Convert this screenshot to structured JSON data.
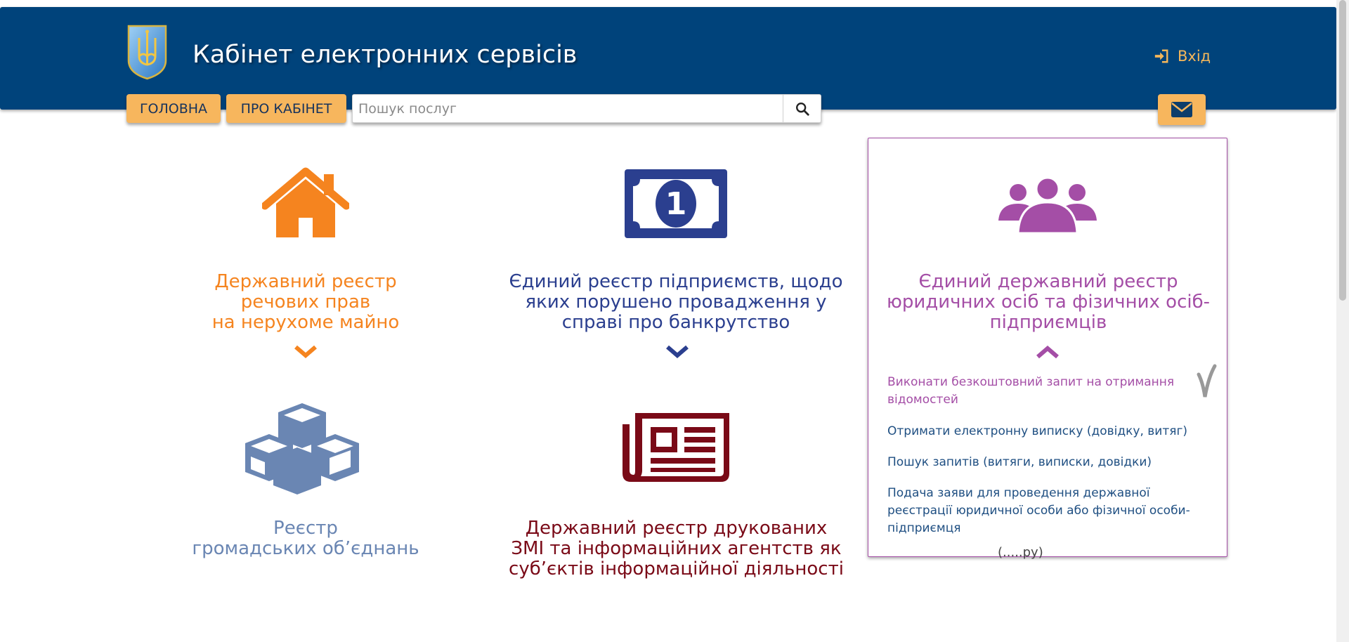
{
  "header": {
    "title": "Кабінет електронних сервісів",
    "login_label": "Вхід",
    "logo_icon": "trident-coat-of-arms-icon",
    "login_icon": "sign-in-icon"
  },
  "nav": {
    "home_label": "ГОЛОВНА",
    "about_label": "ПРО КАБІНЕТ",
    "search_placeholder": "Пошук послуг",
    "search_value": "",
    "search_icon": "search-icon",
    "mail_icon": "envelope-icon"
  },
  "tiles": [
    {
      "title": "Державний реєстр\nречових прав\nна нерухоме майно",
      "color": "#f5841f",
      "icon": "house-icon",
      "expanded": false
    },
    {
      "title": "Єдиний реєстр підприємств, щодо\nяких порушено провадження у\nсправі про банкрутство",
      "color": "#2b3f8f",
      "icon": "banknote-icon",
      "icon_text": "1",
      "expanded": false
    },
    {
      "title": "Єдиний державний реєстр\nюридичних осіб та фізичних осіб-\nпідприємців",
      "color": "#a44ea6",
      "icon": "users-group-icon",
      "expanded": true,
      "links": [
        "Виконати безкоштовний запит на отримання відомостей",
        "Отримати електронну виписку (довідку, витяг)",
        "Пошук запитів (витяги, виписки, довідки)",
        "Подача заяви для проведення державної реєстрації юридичної особи або фізичної особи-підприємця"
      ]
    },
    {
      "title": "Реєстр\nгромадських об’єднань",
      "color": "#6a86b3",
      "icon": "cubes-icon",
      "expanded": false
    },
    {
      "title": "Державний реєстр друкованих\nЗМІ та інформаційних агентств як\nсуб’єктів інформаційної діяльності",
      "color": "#7a0a17",
      "icon": "newspaper-icon",
      "expanded": false
    }
  ],
  "partially_hidden_text": "(.....ру)",
  "colors": {
    "header_bg": "#00437b",
    "button_bg": "#f7b65d",
    "button_text": "#16325c",
    "login_text": "#f5b75a",
    "link_blue": "#1f4f82"
  }
}
